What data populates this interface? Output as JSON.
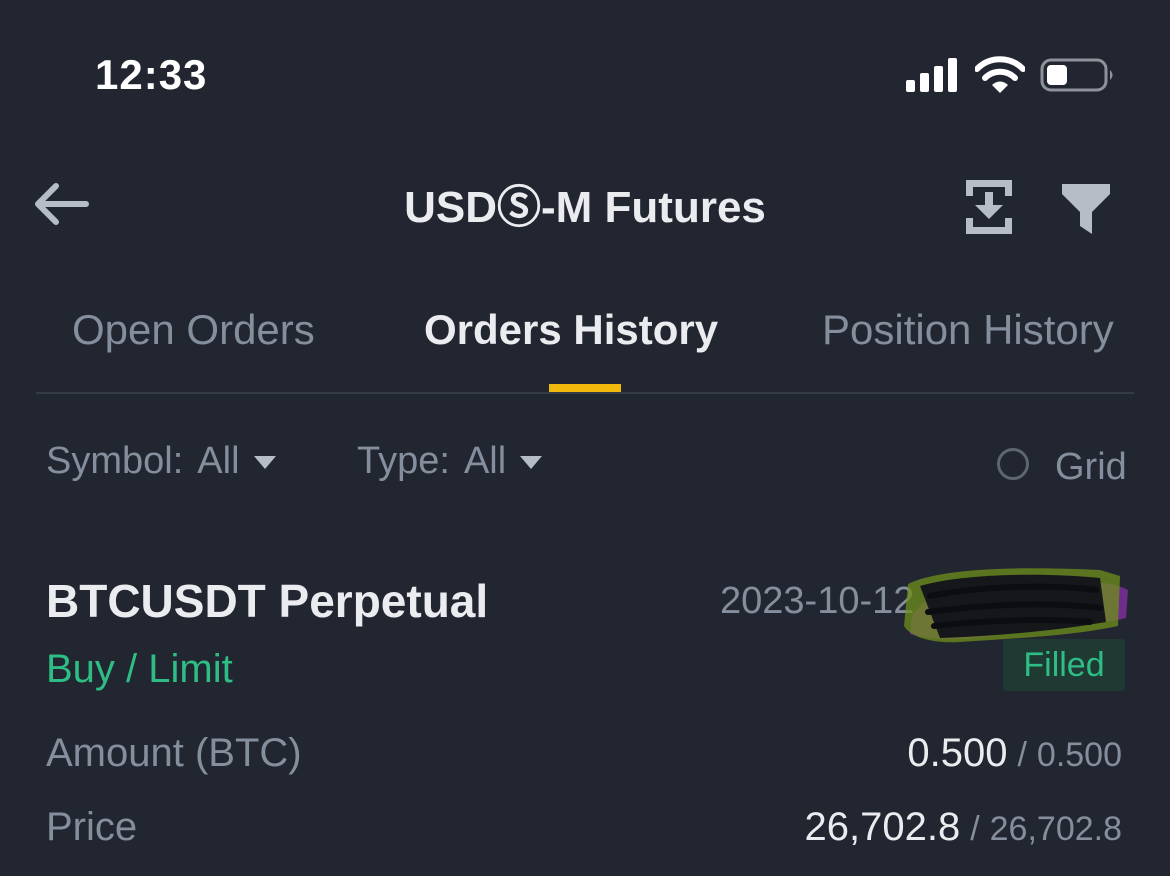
{
  "status_bar": {
    "time": "12:33"
  },
  "header": {
    "title": "USDⓈ-M Futures"
  },
  "tabs": [
    {
      "label": "Open Orders",
      "active": false
    },
    {
      "label": "Orders History",
      "active": true
    },
    {
      "label": "Position History",
      "active": false
    }
  ],
  "filters": {
    "symbol_label": "Symbol:",
    "symbol_value": "All",
    "type_label": "Type:",
    "type_value": "All",
    "grid_label": "Grid",
    "grid_checked": false
  },
  "order": {
    "symbol": "BTCUSDT Perpetual",
    "date": "2023-10-12",
    "side_type": "Buy / Limit",
    "status": "Filled",
    "amount_label": "Amount (BTC)",
    "amount_filled": "0.500",
    "amount_total": "0.500",
    "price_label": "Price",
    "price_avg": "26,702.8",
    "price_order": "26,702.8",
    "separator": "/"
  },
  "colors": {
    "background": "#222630",
    "accent": "#f0b90b",
    "buy": "#2ebd85",
    "text_primary": "#eaecef",
    "text_secondary": "#848e9c"
  },
  "icons": {
    "back": "arrow-left-icon",
    "export": "export-icon",
    "filter": "funnel-icon",
    "signal": "cellular-signal-icon",
    "wifi": "wifi-icon",
    "battery": "battery-icon"
  }
}
